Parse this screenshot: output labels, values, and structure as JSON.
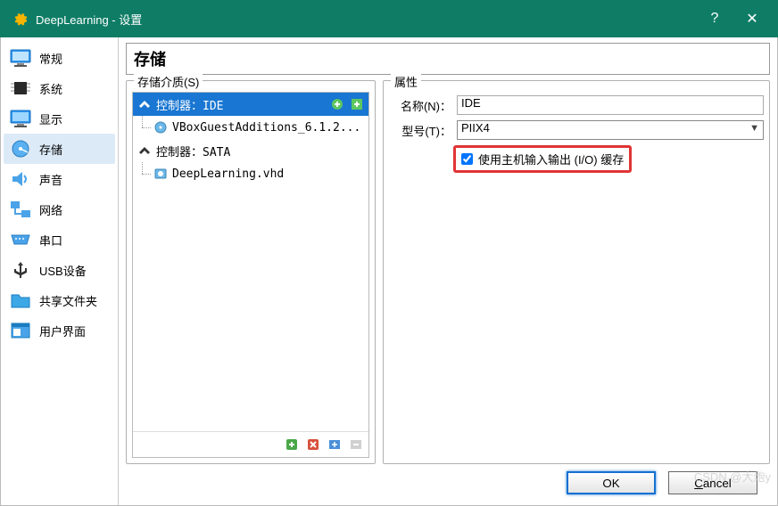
{
  "window": {
    "title": "DeepLearning - 设置",
    "help": "?",
    "close": "✕"
  },
  "sidebar": {
    "items": [
      {
        "label": "常规"
      },
      {
        "label": "系统"
      },
      {
        "label": "显示"
      },
      {
        "label": "存储"
      },
      {
        "label": "声音"
      },
      {
        "label": "网络"
      },
      {
        "label": "串口"
      },
      {
        "label": "USB设备"
      },
      {
        "label": "共享文件夹"
      },
      {
        "label": "用户界面"
      }
    ]
  },
  "page": {
    "heading": "存储",
    "tree_legend": "存储介质(S)",
    "props_legend": "属性"
  },
  "tree": {
    "ctrl1": {
      "label": "控制器：IDE"
    },
    "ctrl1_child1": {
      "label": "VBoxGuestAdditions_6.1.2..."
    },
    "ctrl2": {
      "label": "控制器：SATA"
    },
    "ctrl2_child1": {
      "label": "DeepLearning.vhd"
    }
  },
  "props": {
    "name_label": "名称(N)：",
    "name_value": "IDE",
    "type_label": "型号(T)：",
    "type_value": "PIIX4",
    "cache_label": "使用主机输入输出 (I/O) 缓存"
  },
  "buttons": {
    "ok": "OK",
    "cancel": "Cancel"
  },
  "watermark": "CSDN @大炮y"
}
